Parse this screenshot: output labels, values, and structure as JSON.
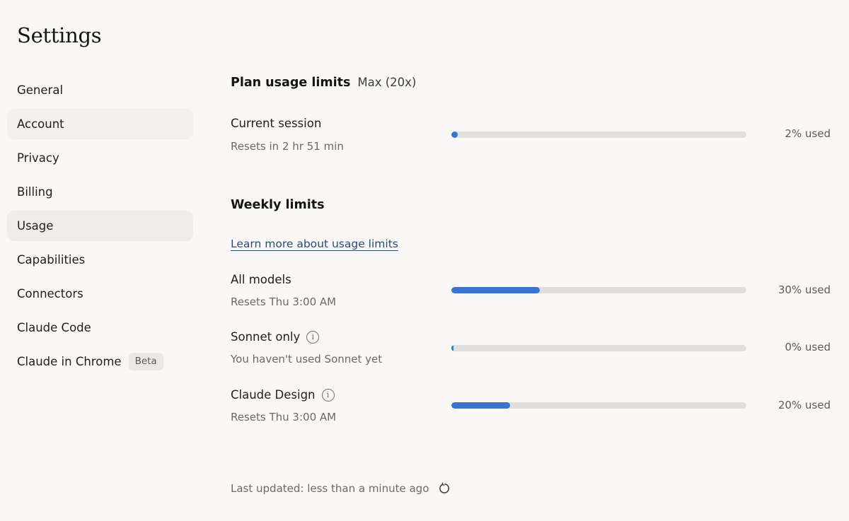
{
  "page_title": "Settings",
  "sidebar": {
    "items": [
      {
        "label": "General"
      },
      {
        "label": "Account"
      },
      {
        "label": "Privacy"
      },
      {
        "label": "Billing"
      },
      {
        "label": "Usage"
      },
      {
        "label": "Capabilities"
      },
      {
        "label": "Connectors"
      },
      {
        "label": "Claude Code"
      },
      {
        "label": "Claude in Chrome",
        "badge": "Beta"
      }
    ],
    "active_item": "Usage",
    "hovered_item": "Account"
  },
  "plan": {
    "title": "Plan usage limits",
    "plan_name": "Max (20x)",
    "current_session": {
      "label": "Current session",
      "sub": "Resets in 2 hr 51 min",
      "percent": 2,
      "used_text": "2% used"
    }
  },
  "weekly": {
    "title": "Weekly limits",
    "learn_more": "Learn more about usage limits",
    "rows": [
      {
        "label": "All models",
        "sub": "Resets Thu 3:00 AM",
        "percent": 30,
        "used_text": "30% used",
        "info_icon": false
      },
      {
        "label": "Sonnet only",
        "sub": "You haven't used Sonnet yet",
        "percent": 0,
        "used_text": "0% used",
        "info_icon": true
      },
      {
        "label": "Claude Design",
        "sub": "Resets Thu 3:00 AM",
        "percent": 20,
        "used_text": "20% used",
        "info_icon": true
      }
    ]
  },
  "footer": {
    "last_updated": "Last updated: less than a minute ago",
    "refresh_icon": "refresh-icon"
  },
  "colors": {
    "accent": "#3b73d1",
    "track": "#e1dfdb",
    "background": "#f9f8f6",
    "link": "#2f4a73"
  }
}
